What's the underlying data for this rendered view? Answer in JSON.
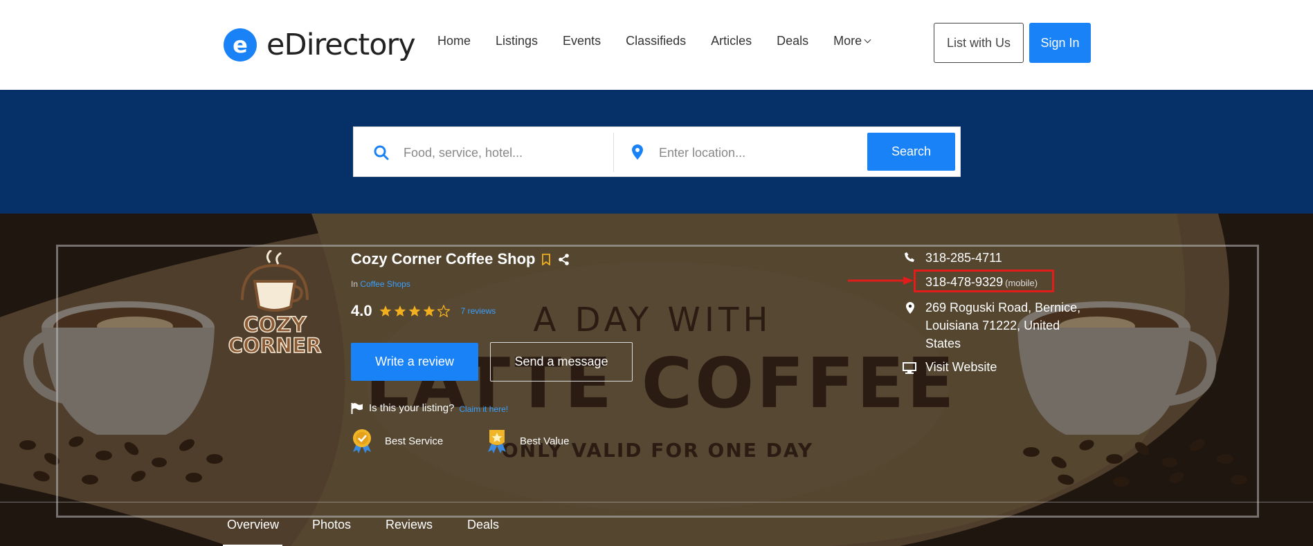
{
  "header": {
    "logo_letter": "e",
    "logo_text": "eDirectory",
    "nav": [
      "Home",
      "Listings",
      "Events",
      "Classifieds",
      "Articles",
      "Deals",
      "More"
    ],
    "list_with_us": "List with Us",
    "sign_in": "Sign In",
    "accent_color": "#1a82f7"
  },
  "search": {
    "keyword_placeholder": "Food, service, hotel...",
    "location_placeholder": "Enter location...",
    "button": "Search",
    "band_color": "#053068"
  },
  "hero_image": {
    "line1": "A DAY WITH",
    "line2": "LATTE COFFEE",
    "line3": "ONLY VALID FOR ONE DAY"
  },
  "listing": {
    "logo_text_1": "COZY",
    "logo_text_2": "CORNER",
    "title": "Cozy Corner Coffee Shop",
    "category_prefix": "In",
    "category": "Coffee Shops",
    "rating": "4.0",
    "stars_filled": 4,
    "stars_total": 5,
    "reviews": "7 reviews",
    "write_review": "Write a review",
    "send_message": "Send a message",
    "claim_question": "Is this your listing?",
    "claim_link": "Claim it here!",
    "badges": [
      {
        "label": "Best Service",
        "icon": "ribbon-check-icon"
      },
      {
        "label": "Best Value",
        "icon": "ribbon-star-icon"
      }
    ]
  },
  "contact": {
    "phone": "318-285-4711",
    "mobile": "318-478-9329",
    "mobile_tag": "(mobile)",
    "address": "269 Roguski Road, Bernice, Louisiana 71222, United States",
    "website": "Visit Website",
    "highlight_color": "#e21b1b"
  },
  "tabs": [
    "Overview",
    "Photos",
    "Reviews",
    "Deals"
  ],
  "active_tab": "Overview"
}
